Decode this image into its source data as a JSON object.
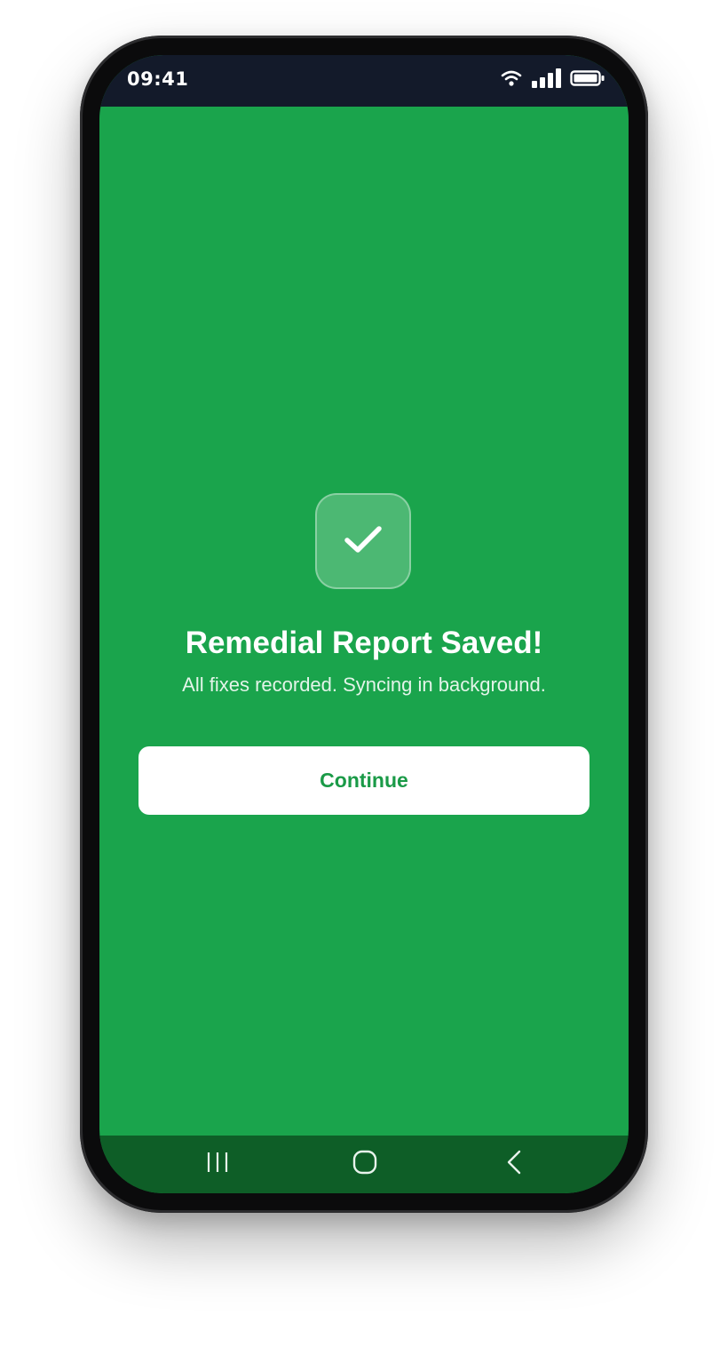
{
  "status_bar": {
    "time": "09:41",
    "icons": [
      "wifi-icon",
      "signal-icon",
      "battery-icon"
    ]
  },
  "success": {
    "icon": "checkmark-icon",
    "title": "Remedial Report Saved!",
    "subtitle": "All fixes recorded. Syncing in background.",
    "continue_label": "Continue"
  },
  "nav_bar": {
    "buttons": [
      "recent-apps-icon",
      "home-icon",
      "back-icon"
    ]
  },
  "colors": {
    "background": "#1aa44c",
    "status_bar": "#131a2a",
    "nav_bar": "#0e5e27",
    "button_text": "#1a9a47"
  }
}
